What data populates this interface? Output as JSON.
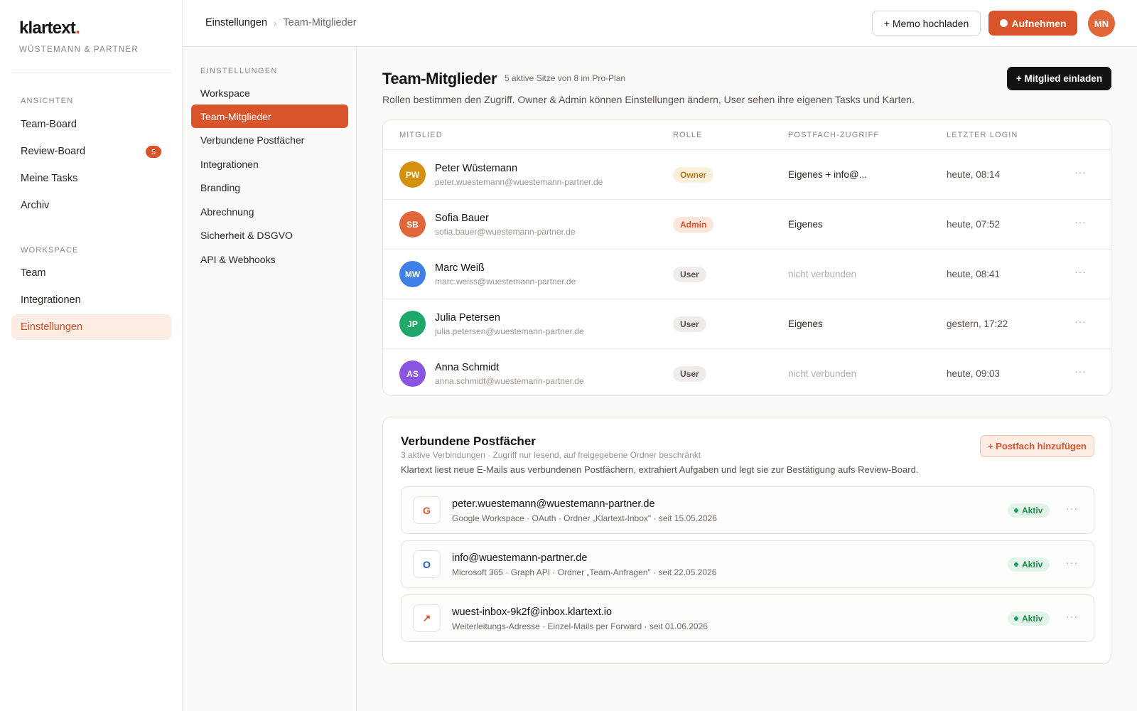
{
  "app": {
    "brand_name": "klartext",
    "brand_dot": ".",
    "company": "WÜSTEMANN & PARTNER"
  },
  "sidebar": {
    "section_views": "ANSICHTEN",
    "views": [
      {
        "label": "Team-Board"
      },
      {
        "label": "Review-Board",
        "badge": "5"
      },
      {
        "label": "Meine Tasks"
      },
      {
        "label": "Archiv"
      }
    ],
    "section_workspace": "WORKSPACE",
    "workspace": [
      {
        "label": "Team"
      },
      {
        "label": "Integrationen"
      },
      {
        "label": "Einstellungen",
        "active": true
      }
    ]
  },
  "topbar": {
    "breadcrumb_root": "Einstellungen",
    "breadcrumb_sep": "›",
    "breadcrumb_current": "Team-Mitglieder",
    "upload_label": "+ Memo hochladen",
    "record_label": "Aufnehmen",
    "user_initials": "MN"
  },
  "settings_nav": {
    "title": "EINSTELLUNGEN",
    "items": [
      {
        "label": "Workspace"
      },
      {
        "label": "Team-Mitglieder",
        "active": true
      },
      {
        "label": "Verbundene Postfächer"
      },
      {
        "label": "Integrationen"
      },
      {
        "label": "Branding"
      },
      {
        "label": "Abrechnung"
      },
      {
        "label": "Sicherheit & DSGVO"
      },
      {
        "label": "API & Webhooks"
      }
    ]
  },
  "page": {
    "title": "Team-Mitglieder",
    "meta": "5 aktive Sitze von 8 im Pro-Plan",
    "description": "Rollen bestimmen den Zugriff. Owner & Admin können Einstellungen ändern, User sehen ihre eigenen Tasks und Karten.",
    "invite_label": "+ Mitglied einladen"
  },
  "members_table": {
    "headers": {
      "member": "MITGLIED",
      "role": "ROLLE",
      "mailbox": "POSTFACH-ZUGRIFF",
      "last_login": "LETZTER LOGIN"
    },
    "more_label": "···",
    "rows": [
      {
        "initials": "PW",
        "name": "Peter Wüstemann",
        "email": "peter.wuestemann@wuestemann-partner.de",
        "role": "Owner",
        "access": "Eigenes + info@...",
        "last_login": "heute, 08:14",
        "avatar_color": "#d4900f"
      },
      {
        "initials": "SB",
        "name": "Sofia Bauer",
        "email": "sofia.bauer@wuestemann-partner.de",
        "role": "Admin",
        "access": "Eigenes",
        "last_login": "heute, 07:52",
        "avatar_color": "#e0673a"
      },
      {
        "initials": "MW",
        "name": "Marc Weiß",
        "email": "marc.weiss@wuestemann-partner.de",
        "role": "User",
        "access": "nicht verbunden",
        "last_login": "heute, 08:41",
        "avatar_color": "#3f7fe6"
      },
      {
        "initials": "JP",
        "name": "Julia Petersen",
        "email": "julia.petersen@wuestemann-partner.de",
        "role": "User",
        "access": "Eigenes",
        "last_login": "gestern, 17:22",
        "avatar_color": "#1ea86a"
      },
      {
        "initials": "AS",
        "name": "Anna Schmidt",
        "email": "anna.schmidt@wuestemann-partner.de",
        "role": "User",
        "access": "nicht verbunden",
        "last_login": "heute, 09:03",
        "avatar_color": "#8a55e0"
      }
    ]
  },
  "mailboxes": {
    "title": "Verbundene Postfächer",
    "meta": "3 aktive Verbindungen · Zugriff nur lesend, auf freigegebene Ordner beschränkt",
    "description": "Klartext liest neue E-Mails aus verbundenen Postfächern, extrahiert Aufgaben und legt sie zur Bestätigung aufs Review-Board.",
    "add_label": "+ Postfach hinzufügen",
    "items": [
      {
        "icon": "G",
        "icon_name": "google-icon",
        "icon_color": "#d9542b",
        "address": "peter.wuestemann@wuestemann-partner.de",
        "details": "Google Workspace · OAuth · Ordner „Klartext-Inbox\" · seit 15.05.2026",
        "status": "Aktiv"
      },
      {
        "icon": "O",
        "icon_name": "outlook-icon",
        "icon_color": "#1f5fbf",
        "address": "info@wuestemann-partner.de",
        "details": "Microsoft 365 · Graph API · Ordner „Team-Anfragen\" · seit 22.05.2026",
        "status": "Aktiv"
      },
      {
        "icon": "↗",
        "icon_name": "forward-arrow-icon",
        "icon_color": "#d9542b",
        "address": "wuest-inbox-9k2f@inbox.klartext.io",
        "details": "Weiterleitungs-Adresse · Einzel-Mails per Forward · seit 01.06.2026",
        "status": "Aktiv"
      }
    ]
  }
}
